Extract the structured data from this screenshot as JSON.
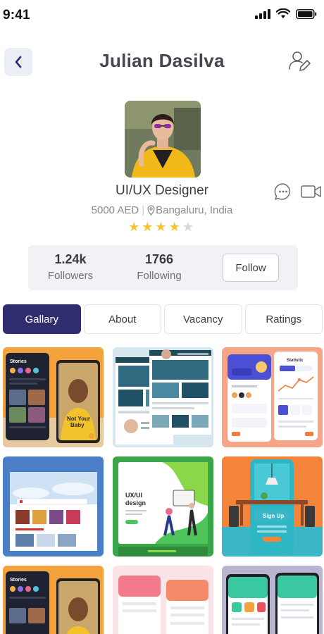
{
  "status_bar": {
    "time": "9:41"
  },
  "header": {
    "title": "Julian Dasilva"
  },
  "profile": {
    "job_title": "UI/UX Designer",
    "rate": "5000 AED",
    "location": "Bangaluru, India",
    "rating": 4,
    "rating_max": 5
  },
  "stats": {
    "followers_value": "1.24k",
    "followers_label": "Followers",
    "following_value": "1766",
    "following_label": "Following",
    "follow_label": "Follow"
  },
  "tabs": [
    {
      "label": "Gallary",
      "active": true
    },
    {
      "label": "About",
      "active": false
    },
    {
      "label": "Vacancy",
      "active": false
    },
    {
      "label": "Ratings",
      "active": false
    }
  ],
  "gallery": {
    "items": [
      {
        "texts": [
          "Stories",
          "Not Your",
          "Baby"
        ]
      },
      {
        "texts": []
      },
      {
        "texts": [
          "Statistic"
        ]
      },
      {
        "texts": []
      },
      {
        "texts": [
          "UX/UI",
          "design"
        ]
      },
      {
        "texts": [
          "Sign Up"
        ]
      },
      {
        "texts": [
          "Stories"
        ]
      },
      {
        "texts": []
      },
      {
        "texts": []
      }
    ]
  },
  "colors": {
    "accent": "#2f2d6d",
    "star": "#f5c431",
    "surface": "#f1f2f6"
  }
}
